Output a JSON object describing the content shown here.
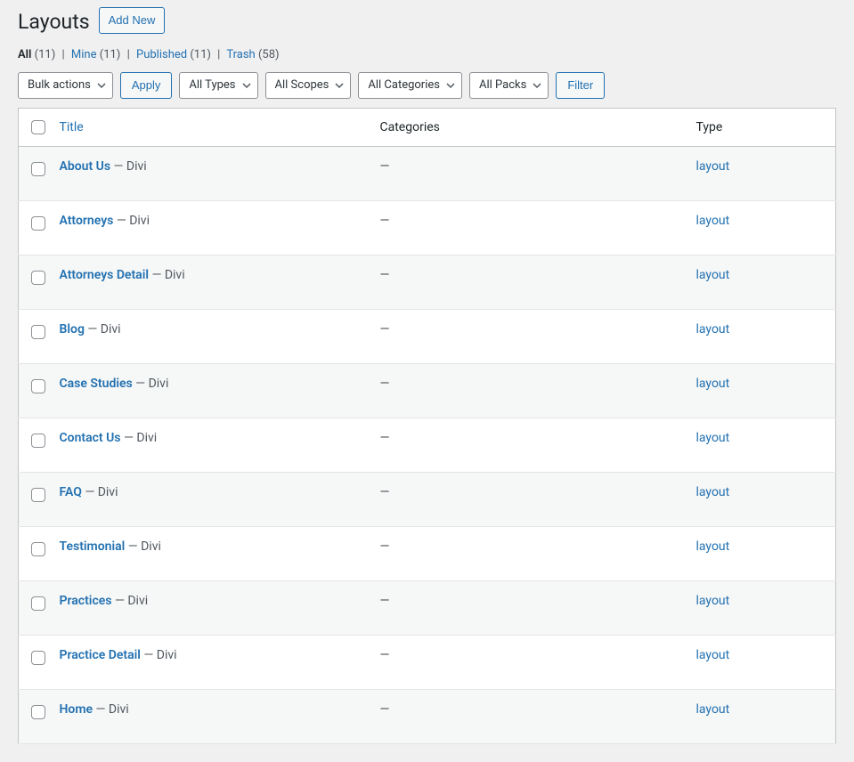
{
  "header": {
    "title": "Layouts",
    "add_new_label": "Add New"
  },
  "views": {
    "all": {
      "label": "All",
      "count": "(11)"
    },
    "mine": {
      "label": "Mine",
      "count": "(11)"
    },
    "published": {
      "label": "Published",
      "count": "(11)"
    },
    "trash": {
      "label": "Trash",
      "count": "(58)"
    },
    "separator": "|"
  },
  "toolbar": {
    "bulk_actions": "Bulk actions",
    "apply": "Apply",
    "all_types": "All Types",
    "all_scopes": "All Scopes",
    "all_categories": "All Categories",
    "all_packs": "All Packs",
    "filter": "Filter"
  },
  "columns": {
    "title": "Title",
    "categories": "Categories",
    "type": "Type"
  },
  "rows": [
    {
      "title": "About Us",
      "suffix": " — Divi",
      "categories": "—",
      "type": "layout"
    },
    {
      "title": "Attorneys",
      "suffix": " — Divi",
      "categories": "—",
      "type": "layout"
    },
    {
      "title": "Attorneys Detail",
      "suffix": " — Divi",
      "categories": "—",
      "type": "layout"
    },
    {
      "title": "Blog",
      "suffix": " — Divi",
      "categories": "—",
      "type": "layout"
    },
    {
      "title": "Case Studies",
      "suffix": " — Divi",
      "categories": "—",
      "type": "layout"
    },
    {
      "title": "Contact Us",
      "suffix": " — Divi",
      "categories": "—",
      "type": "layout"
    },
    {
      "title": "FAQ",
      "suffix": " — Divi",
      "categories": "—",
      "type": "layout"
    },
    {
      "title": "Testimonial",
      "suffix": " — Divi",
      "categories": "—",
      "type": "layout"
    },
    {
      "title": "Practices",
      "suffix": " — Divi",
      "categories": "—",
      "type": "layout"
    },
    {
      "title": "Practice Detail",
      "suffix": " — Divi",
      "categories": "—",
      "type": "layout"
    },
    {
      "title": "Home",
      "suffix": " — Divi",
      "categories": "—",
      "type": "layout"
    }
  ]
}
